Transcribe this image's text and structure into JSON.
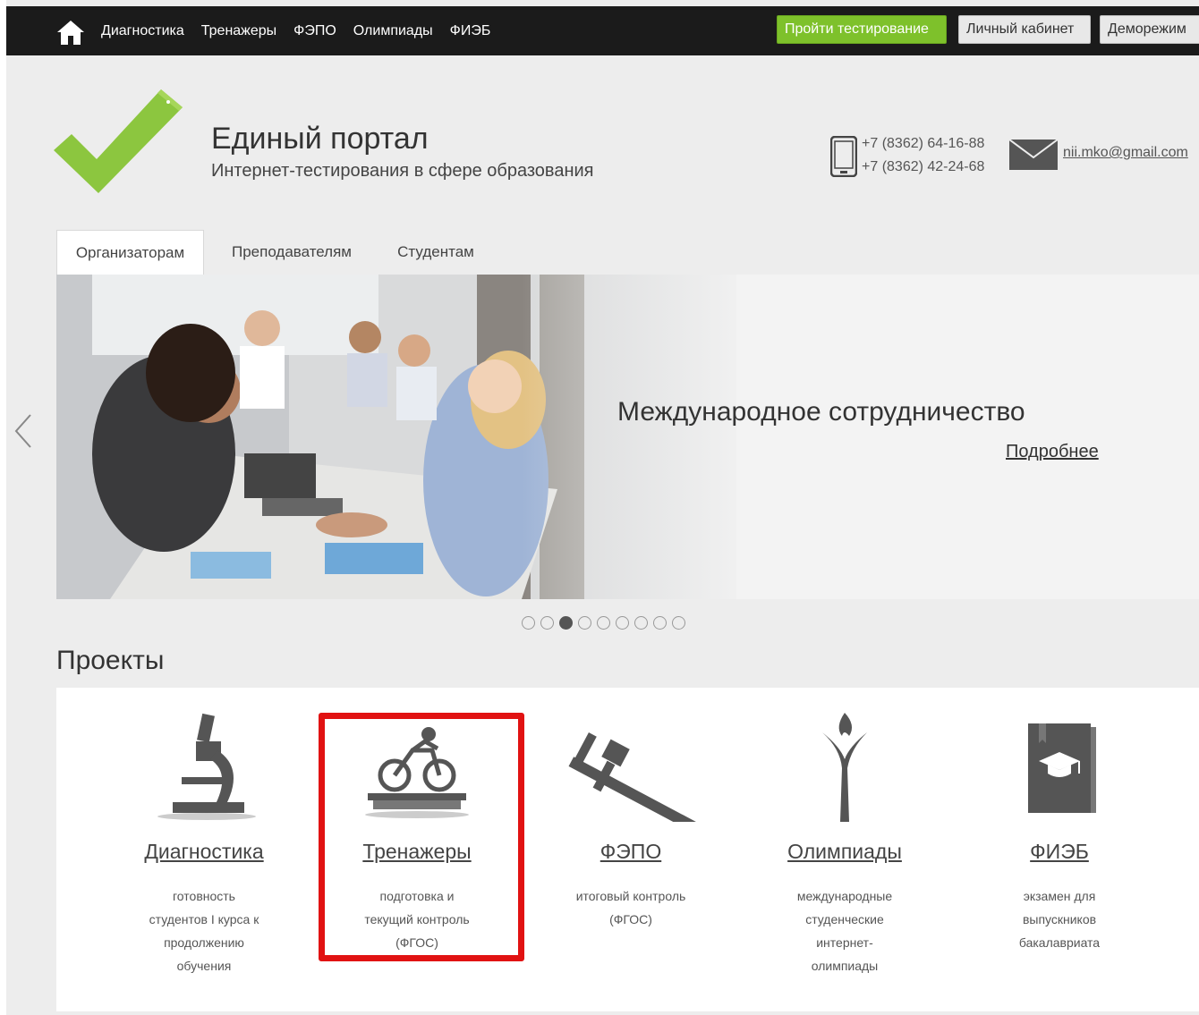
{
  "nav": {
    "links": [
      "Диагностика",
      "Тренажеры",
      "ФЭПО",
      "Олимпиады",
      "ФИЭБ"
    ],
    "test_button": "Пройти тестирование",
    "cabinet_button": "Личный кабинет",
    "demo_button": "Деморежим"
  },
  "header": {
    "title": "Единый портал",
    "subtitle": "Интернет-тестирования в сфере образования",
    "phone1": "+7 (8362) 64-16-88",
    "phone2": "+7 (8362) 42-24-68",
    "email": "nii.mko@gmail.com"
  },
  "tabs": [
    "Организаторам",
    "Преподавателям",
    "Студентам"
  ],
  "slider": {
    "title": "Международное сотрудничество",
    "more_link": "Подробнее",
    "dot_count": 9,
    "active_dot": 3
  },
  "projects": {
    "heading": "Проекты",
    "items": [
      {
        "name": "Диагностика",
        "icon": "microscope-icon",
        "desc": [
          "готовность",
          "студентов I курса к",
          "продолжению",
          "обучения"
        ]
      },
      {
        "name": "Тренажеры",
        "icon": "cyclist-icon",
        "desc": [
          "подготовка и",
          "текущий контроль",
          "(ФГОС)"
        ]
      },
      {
        "name": "ФЭПО",
        "icon": "caliper-icon",
        "desc": [
          "итоговый контроль",
          "(ФГОС)"
        ]
      },
      {
        "name": "Олимпиады",
        "icon": "flame-figure-icon",
        "desc": [
          "международные",
          "студенческие",
          "интернет-",
          "олимпиады"
        ]
      },
      {
        "name": "ФИЭБ",
        "icon": "graduation-book-icon",
        "desc": [
          "экзамен для",
          "выпускников",
          "бакалавриата"
        ]
      }
    ]
  },
  "colors": {
    "accent_green": "#7ec12b",
    "highlight_red": "#e11212",
    "topbar": "#1b1b1b"
  }
}
